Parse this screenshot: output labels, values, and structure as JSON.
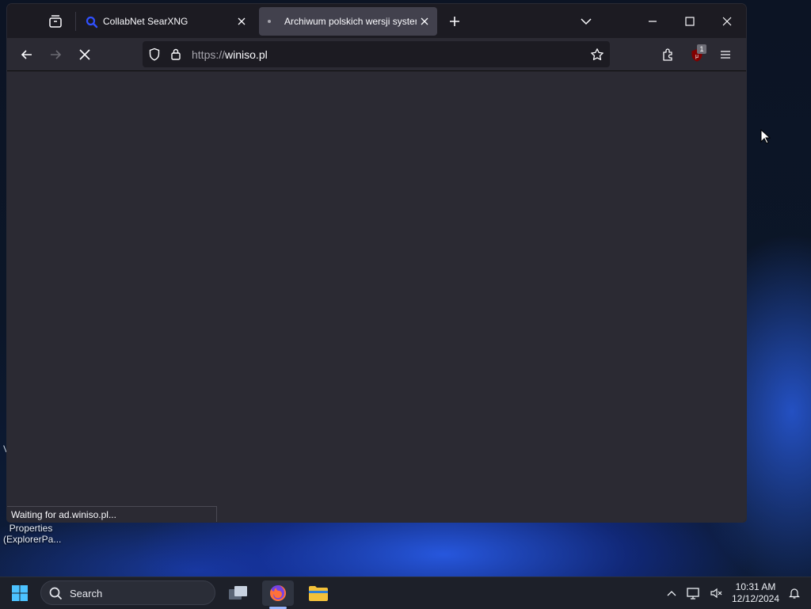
{
  "browser": {
    "tabs": [
      {
        "title": "CollabNet SearXNG",
        "active": false,
        "favicon": "search-favicon"
      },
      {
        "title": "Archiwum polskich wersji systemów Windows",
        "active": true,
        "favicon": "loading-dot"
      }
    ],
    "url_scheme": "https://",
    "url_host": "winiso.pl",
    "extension_badge": "1",
    "status_text": "Waiting for ad.winiso.pl..."
  },
  "desktop": {
    "icon_label_line1": "Properties",
    "icon_label_line2": "(ExplorerPa..."
  },
  "taskbar": {
    "search_label": "Search",
    "clock_time": "10:31 AM",
    "clock_date": "12/12/2024"
  },
  "colors": {
    "firefox_accent": "#ff7139",
    "active_indicator": "#9ab7ff",
    "folder_yellow": "#f3c13a"
  }
}
